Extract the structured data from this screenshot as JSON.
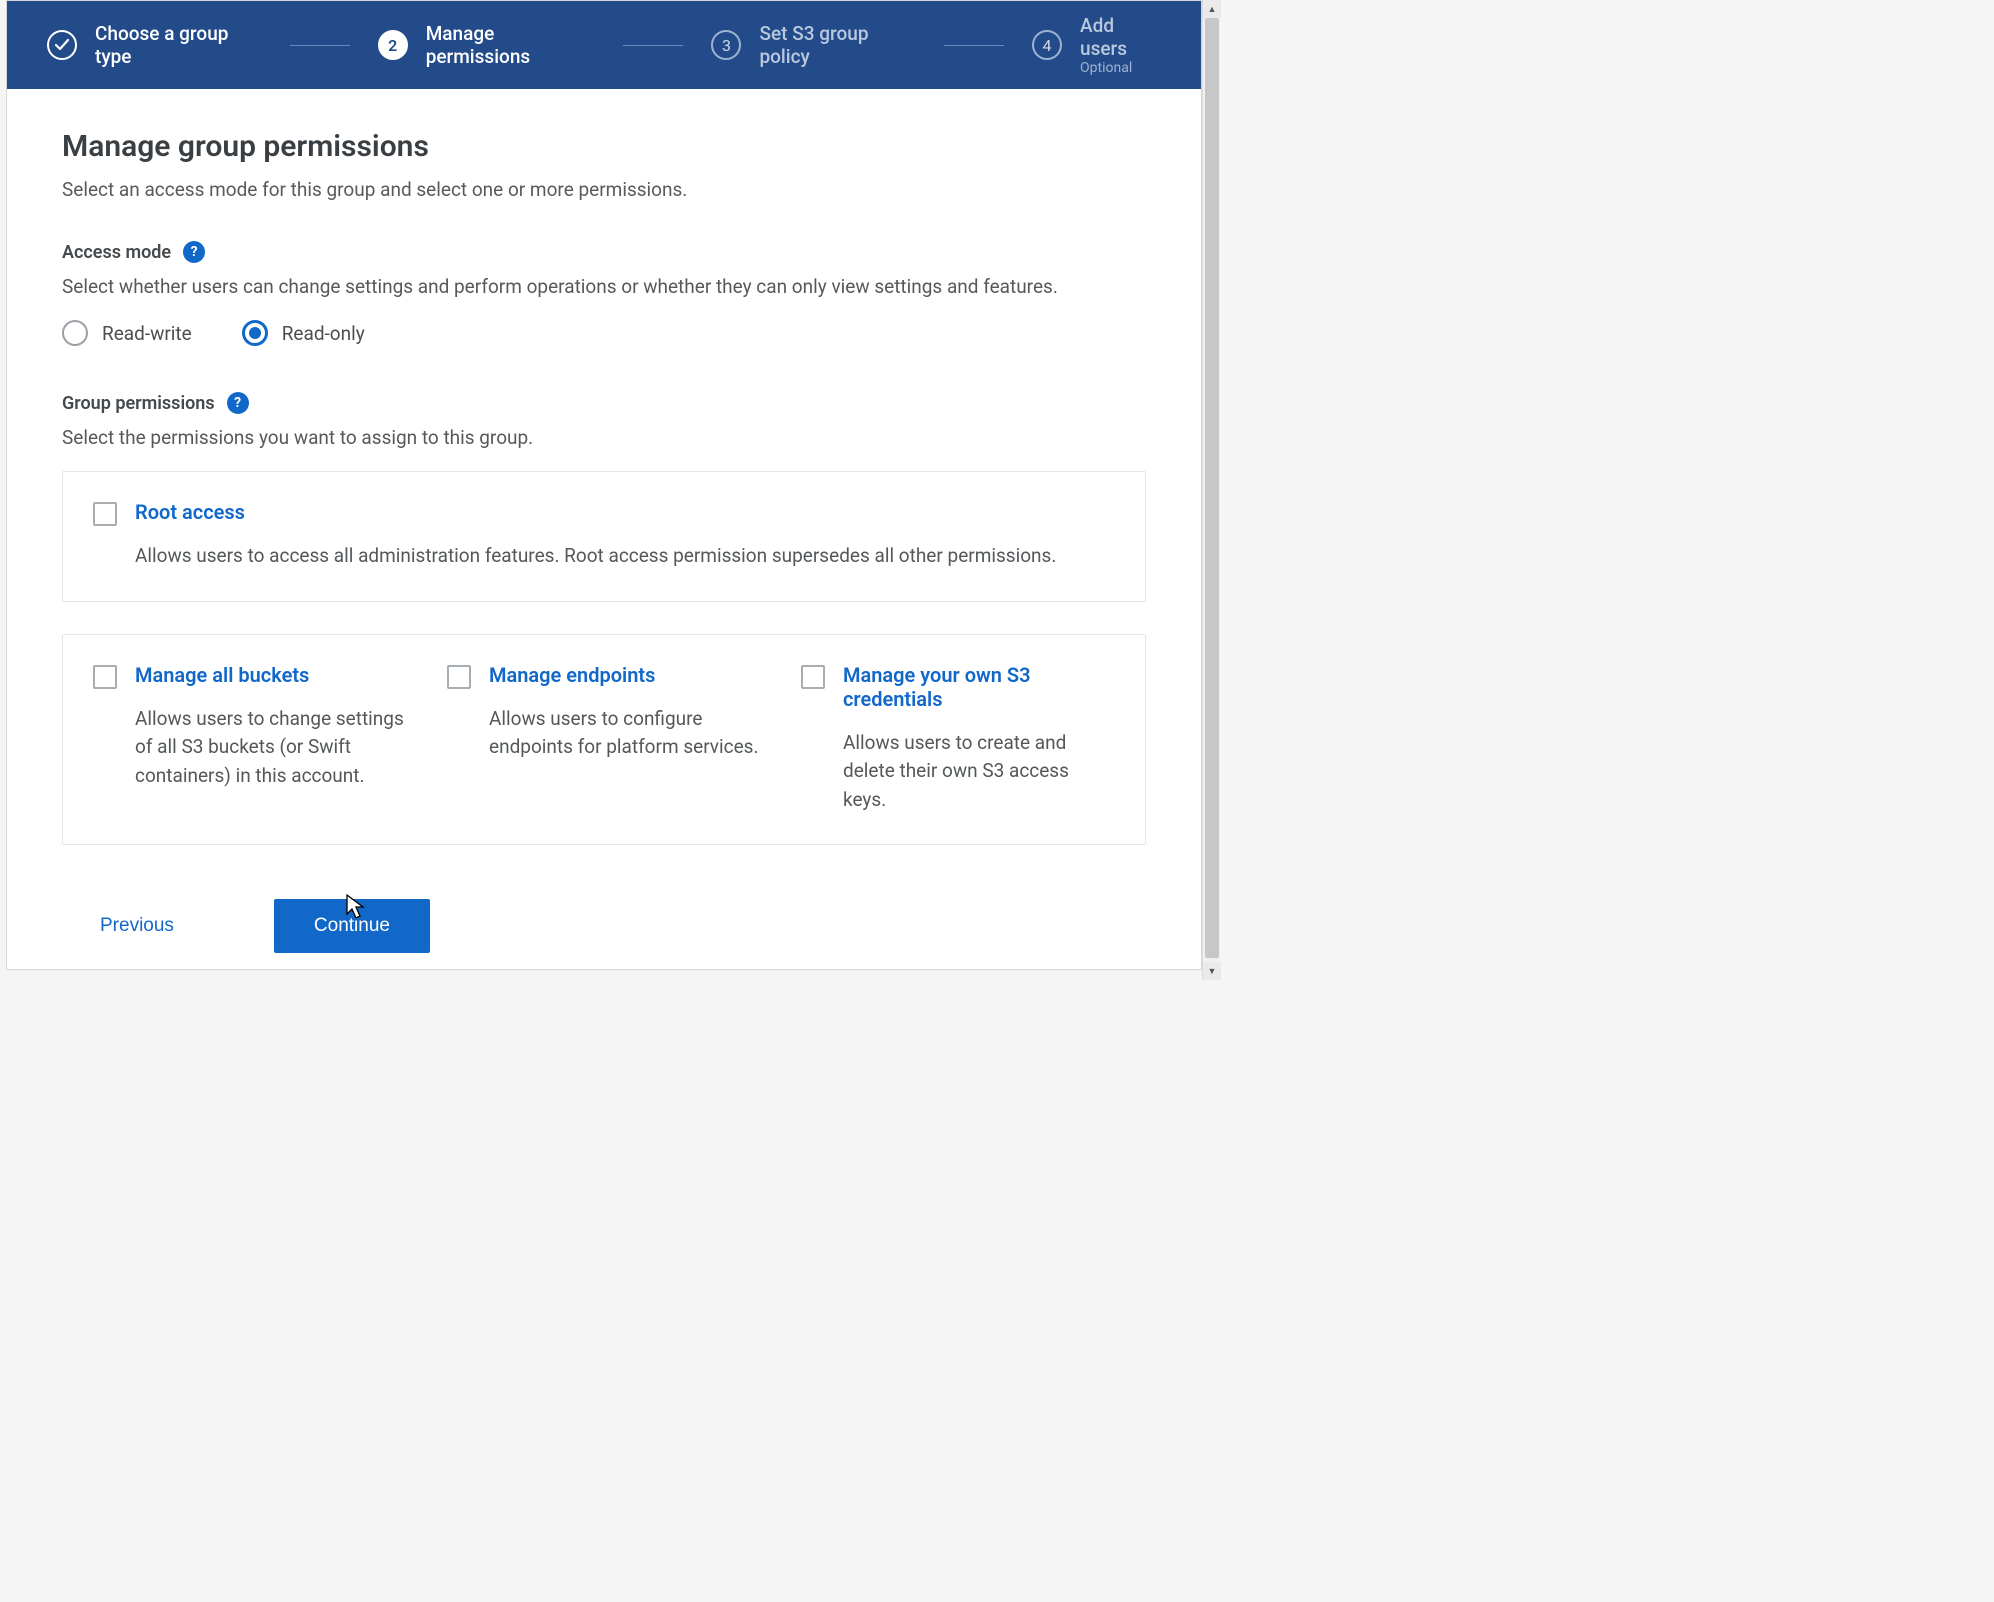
{
  "stepper": {
    "steps": [
      {
        "label": "Choose a group type",
        "state": "done"
      },
      {
        "label": "Manage permissions",
        "number": "2",
        "state": "active"
      },
      {
        "label": "Set S3 group policy",
        "number": "3",
        "state": "pending"
      },
      {
        "label": "Add users",
        "sub": "Optional",
        "number": "4",
        "state": "pending"
      }
    ]
  },
  "page": {
    "title": "Manage group permissions",
    "subtitle": "Select an access mode for this group and select one or more permissions."
  },
  "access_mode": {
    "label": "Access mode",
    "desc": "Select whether users can change settings and perform operations or whether they can only view settings and features.",
    "options": {
      "rw": "Read-write",
      "ro": "Read-only"
    },
    "selected": "ro"
  },
  "group_permissions": {
    "label": "Group permissions",
    "desc": "Select the permissions you want to assign to this group.",
    "root": {
      "title": "Root access",
      "desc": "Allows users to access all administration features. Root access permission supersedes all other permissions."
    },
    "items": [
      {
        "title": "Manage all buckets",
        "desc": "Allows users to change settings of all S3 buckets (or Swift containers) in this account."
      },
      {
        "title": "Manage endpoints",
        "desc": "Allows users to configure endpoints for platform services."
      },
      {
        "title": "Manage your own S3 credentials",
        "desc": "Allows users to create and delete their own S3 access keys."
      }
    ]
  },
  "buttons": {
    "previous": "Previous",
    "continue": "Continue"
  }
}
